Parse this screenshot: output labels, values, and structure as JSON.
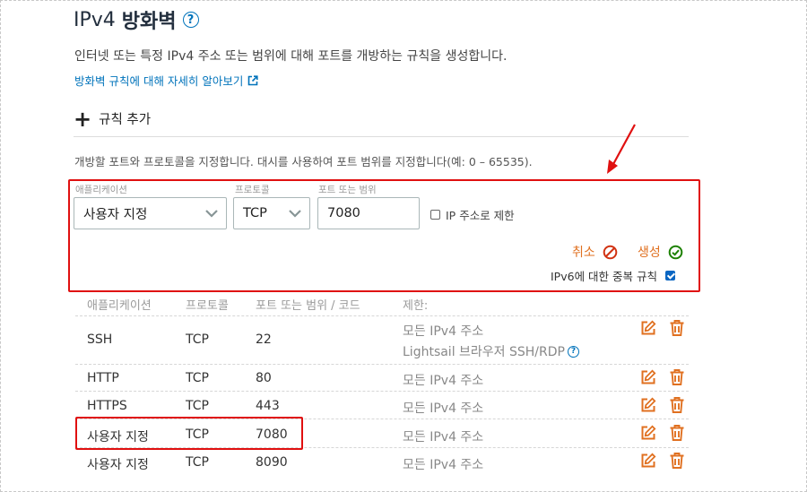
{
  "header": {
    "title_prefix": "IPv4",
    "title_bold": "방화벽",
    "help_glyph": "?",
    "description": "인터넷 또는 특정 IPv4 주소 또는 범위에 대해 포트를 개방하는 규칙을 생성합니다.",
    "learn_more_link": "방화벽 규칙에 대해 자세히 알아보기"
  },
  "add_rule": {
    "plus": "+",
    "label": "규칙 추가",
    "hint": "개방할 포트와 프로토콜을 지정합니다. 대시를 사용하여 포트 범위를 지정합니다(예: 0 – 65535)."
  },
  "form": {
    "application_label": "애플리케이션",
    "application_value": "사용자 지정",
    "protocol_label": "프로토콜",
    "protocol_value": "TCP",
    "port_label": "포트 또는 범위",
    "port_value": "7080",
    "ip_restrict_label": "IP 주소로 제한",
    "ip_restrict_checked": false,
    "cancel_label": "취소",
    "create_label": "생성",
    "ipv6_duplicate_label": "IPv6에 대한 중복 규칙",
    "ipv6_duplicate_checked": true
  },
  "table": {
    "headers": [
      "애플리케이션",
      "프로토콜",
      "포트 또는 범위 / 코드",
      "제한:"
    ],
    "rows": [
      {
        "app": "SSH",
        "protocol": "TCP",
        "port": "22",
        "restriction": "모든 IPv4 주소",
        "restriction_extra": "Lightsail 브라우저 SSH/RDP"
      },
      {
        "app": "HTTP",
        "protocol": "TCP",
        "port": "80",
        "restriction": "모든 IPv4 주소"
      },
      {
        "app": "HTTPS",
        "protocol": "TCP",
        "port": "443",
        "restriction": "모든 IPv4 주소"
      },
      {
        "app": "사용자 지정",
        "protocol": "TCP",
        "port": "7080",
        "restriction": "모든 IPv4 주소"
      },
      {
        "app": "사용자 지정",
        "protocol": "TCP",
        "port": "8090",
        "restriction": "모든 IPv4 주소"
      }
    ]
  },
  "colors": {
    "accent_link": "#0073bb",
    "annotation_red": "#e01010",
    "action_orange": "#e07020",
    "create_green": "#1d8102"
  },
  "icons": {
    "help": "question-circle-icon",
    "external": "external-link-icon",
    "dropdown": "chevron-down-icon",
    "cancel": "prohibited-icon",
    "create": "check-circle-icon",
    "edit": "edit-icon",
    "delete": "trash-icon"
  }
}
